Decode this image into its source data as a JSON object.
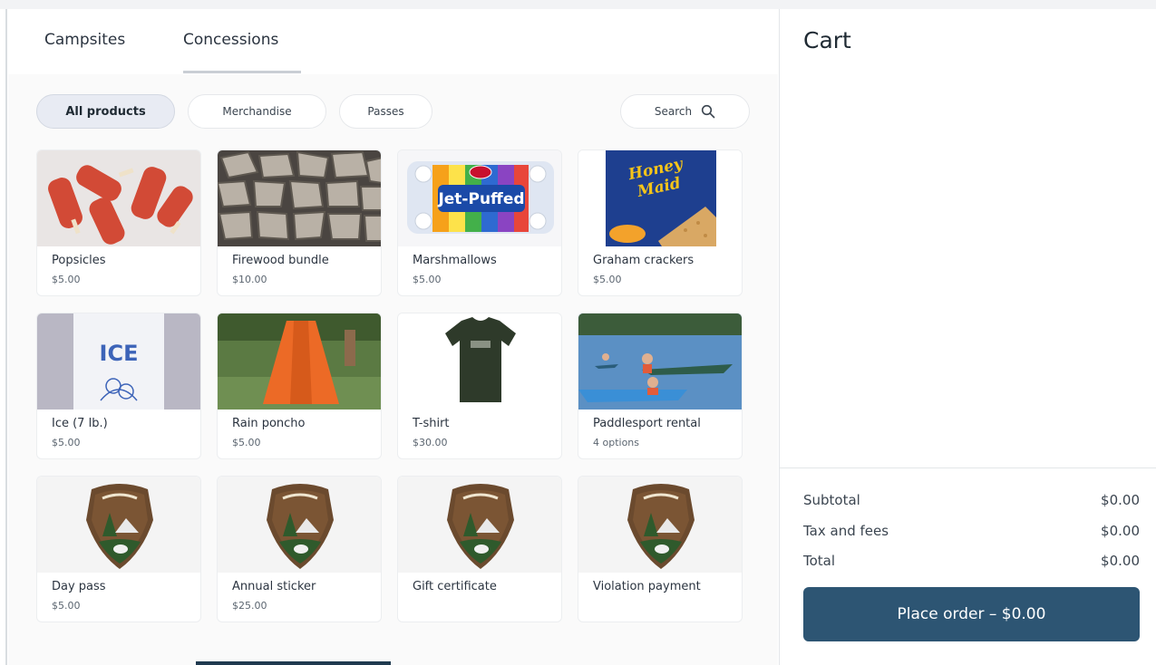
{
  "tabs": [
    {
      "label": "Campsites",
      "active": false
    },
    {
      "label": "Concessions",
      "active": true
    }
  ],
  "filters": [
    {
      "label": "All products",
      "active": true
    },
    {
      "label": "Merchandise",
      "active": false
    },
    {
      "label": "Passes",
      "active": false
    }
  ],
  "search": {
    "label": "Search",
    "icon": "search-icon"
  },
  "products": [
    {
      "name": "Popsicles",
      "price": "$5.00",
      "image": "popsicles"
    },
    {
      "name": "Firewood bundle",
      "price": "$10.00",
      "image": "firewood"
    },
    {
      "name": "Marshmallows",
      "price": "$5.00",
      "image": "marshmallows",
      "image_text": "Jet-Puffed"
    },
    {
      "name": "Graham crackers",
      "price": "$5.00",
      "image": "graham-crackers",
      "image_text": "Honey Maid"
    },
    {
      "name": "Ice (7 lb.)",
      "price": "$5.00",
      "image": "ice-bag",
      "image_text": "ICE"
    },
    {
      "name": "Rain poncho",
      "price": "$5.00",
      "image": "poncho"
    },
    {
      "name": "T-shirt",
      "price": "$30.00",
      "image": "tshirt"
    },
    {
      "name": "Paddlesport rental",
      "price": "4 options",
      "image": "paddlesport"
    },
    {
      "name": "Day pass",
      "price": "$5.00",
      "image": "nps-arrowhead"
    },
    {
      "name": "Annual sticker",
      "price": "$25.00",
      "image": "nps-arrowhead"
    },
    {
      "name": "Gift certificate",
      "price": "",
      "image": "nps-arrowhead"
    },
    {
      "name": "Violation payment",
      "price": "",
      "image": "nps-arrowhead"
    }
  ],
  "cart": {
    "title": "Cart",
    "subtotal_label": "Subtotal",
    "subtotal": "$0.00",
    "tax_label": "Tax and fees",
    "tax": "$0.00",
    "total_label": "Total",
    "total": "$0.00",
    "order_button": "Place order – $0.00"
  },
  "colors": {
    "primary_button": "#2d5573",
    "active_chip": "#e8ebf3"
  }
}
